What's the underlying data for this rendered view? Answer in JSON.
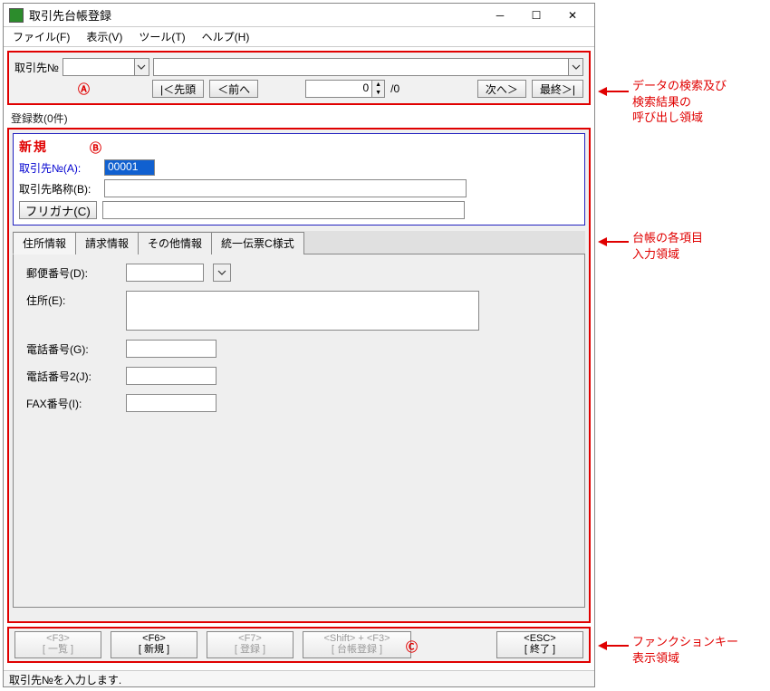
{
  "window": {
    "title": "取引先台帳登録"
  },
  "menubar": {
    "file": "ファイル(F)",
    "view": "表示(V)",
    "tool": "ツール(T)",
    "help": "ヘルプ(H)"
  },
  "sectionA": {
    "label_torihikisaki_no": "取引先№",
    "btn_first": "|＜先頭",
    "btn_prev": "＜前へ",
    "spinner_value": "0",
    "total_suffix": "/0",
    "btn_next": "次へ＞",
    "btn_last": "最終＞|",
    "badge": "Ⓐ"
  },
  "reg_count": "登録数(0件)",
  "sectionB": {
    "new_tag": "新規",
    "badge": "Ⓑ",
    "lbl_no": "取引先№(A):",
    "val_no": "00001",
    "lbl_ryaku": "取引先略称(B):",
    "btn_furigana": "フリガナ(C)"
  },
  "tabs": {
    "t0": "住所情報",
    "t1": "請求情報",
    "t2": "その他情報",
    "t3": "統一伝票C様式"
  },
  "addr": {
    "lbl_zip": "郵便番号(D):",
    "lbl_addr": "住所(E):",
    "lbl_tel1": "電話番号(G):",
    "lbl_tel2": "電話番号2(J):",
    "lbl_fax": "FAX番号(I):"
  },
  "fkeys": {
    "f3_top": "<F3>",
    "f3_bot": "[ 一覧 ]",
    "f6_top": "<F6>",
    "f6_bot": "[ 新規 ]",
    "f7_top": "<F7>",
    "f7_bot": "[ 登録 ]",
    "sf3_top": "<Shift> + <F3>",
    "sf3_bot": "[ 台帳登録 ]",
    "esc_top": "<ESC>",
    "esc_bot": "[ 終了 ]",
    "badge": "Ⓒ"
  },
  "statusbar": "取引先№を入力します.",
  "callouts": {
    "a": "データの検索及び\n検索結果の\n呼び出し領域",
    "b": "台帳の各項目\n入力領域",
    "c": "ファンクションキー\n表示領域"
  }
}
